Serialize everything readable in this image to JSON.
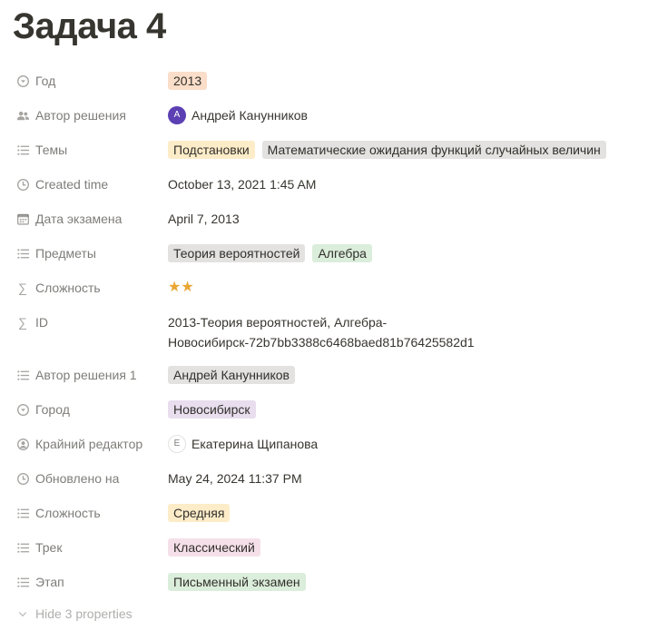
{
  "page": {
    "title": "Задача 4"
  },
  "properties": [
    {
      "icon": "select-icon",
      "label": "Год",
      "values": [
        {
          "text": "2013",
          "color": "orange"
        }
      ]
    },
    {
      "icon": "people-icon",
      "label": "Автор решения",
      "person": {
        "initial": "А",
        "name": "Андрей Канунников"
      }
    },
    {
      "icon": "multiselect-icon",
      "label": "Темы",
      "values": [
        {
          "text": "Подстановки",
          "color": "yellow"
        },
        {
          "text": "Математические ожидания функций случайных величин",
          "color": "gray"
        }
      ]
    },
    {
      "icon": "clock-icon",
      "label": "Created time",
      "text": "October 13, 2021 1:45 AM"
    },
    {
      "icon": "calendar-icon",
      "label": "Дата экзамена",
      "text": "April 7, 2013"
    },
    {
      "icon": "multiselect-icon",
      "label": "Предметы",
      "values": [
        {
          "text": "Теория вероятностей",
          "color": "gray"
        },
        {
          "text": "Алгебра",
          "color": "green"
        }
      ]
    },
    {
      "icon": "formula-icon",
      "label": "Сложность",
      "stars": "★★"
    },
    {
      "icon": "formula-icon",
      "label": "ID",
      "text": "2013-Теория вероятностей, Алгебра-Новосибирск-72b7bb3388c6468baed81b76425582d1"
    },
    {
      "icon": "multiselect-icon",
      "label": "Автор решения 1",
      "values": [
        {
          "text": "Андрей Канунников",
          "color": "gray"
        }
      ]
    },
    {
      "icon": "select-icon",
      "label": "Город",
      "values": [
        {
          "text": "Новосибирск",
          "color": "purple"
        }
      ]
    },
    {
      "icon": "person-icon",
      "label": "Крайний редактор",
      "person": {
        "initial": "Е",
        "name": "Екатерина Щипанова"
      }
    },
    {
      "icon": "clock-icon",
      "label": "Обновлено на",
      "text": "May 24, 2024 11:37 PM"
    },
    {
      "icon": "multiselect-icon",
      "label": "Сложность",
      "values": [
        {
          "text": "Средняя",
          "color": "yellow"
        }
      ]
    },
    {
      "icon": "multiselect-icon",
      "label": "Трек",
      "values": [
        {
          "text": "Классический",
          "color": "pink"
        }
      ]
    },
    {
      "icon": "multiselect-icon",
      "label": "Этап",
      "values": [
        {
          "text": "Письменный экзамен",
          "color": "green"
        }
      ]
    }
  ],
  "footer": {
    "hide_label": "Hide 3 properties",
    "icon": "chevron-down-icon"
  }
}
